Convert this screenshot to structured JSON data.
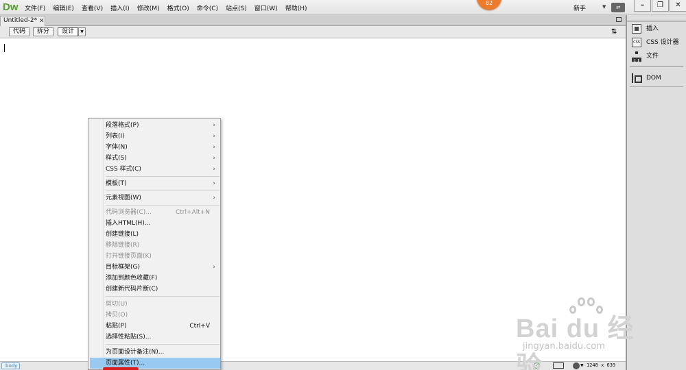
{
  "menubar": {
    "logo": "Dw",
    "items": [
      "文件(F)",
      "编辑(E)",
      "查看(V)",
      "插入(I)",
      "修改(M)",
      "格式(O)",
      "命令(C)",
      "站点(S)",
      "窗口(W)",
      "帮助(H)"
    ],
    "badge": "82",
    "workspace": "新手"
  },
  "document": {
    "tab_label": "Untitled-2*",
    "views": {
      "code": "代码",
      "split": "拆分",
      "design": "设计"
    }
  },
  "statusbar": {
    "tag": "body",
    "size": "1248 x 639"
  },
  "panel": {
    "items": [
      "插入",
      "CSS 设计器",
      "文件",
      "DOM"
    ]
  },
  "context_menu": {
    "items": [
      {
        "label": "段落格式(P)",
        "submenu": true
      },
      {
        "label": "列表(I)",
        "submenu": true
      },
      {
        "label": "字体(N)",
        "submenu": true
      },
      {
        "label": "样式(S)",
        "submenu": true
      },
      {
        "label": "CSS 样式(C)",
        "submenu": true
      },
      {
        "label": "模板(T)",
        "submenu": true
      },
      {
        "label": "元素视图(W)",
        "submenu": true
      },
      {
        "label": "代码浏览器(C)...",
        "shortcut": "Ctrl+Alt+N",
        "disabled": true
      },
      {
        "label": "插入HTML(H)..."
      },
      {
        "label": "创建链接(L)"
      },
      {
        "label": "移除链接(R)",
        "disabled": true
      },
      {
        "label": "打开链接页面(K)",
        "disabled": true
      },
      {
        "label": "目标框架(G)",
        "submenu": true
      },
      {
        "label": "添加到颜色收藏(F)"
      },
      {
        "label": "创建新代码片断(C)"
      },
      {
        "label": "剪切(U)",
        "disabled": true
      },
      {
        "label": "拷贝(O)",
        "disabled": true
      },
      {
        "label": "粘贴(P)",
        "shortcut": "Ctrl+V"
      },
      {
        "label": "选择性粘贴(S)..."
      },
      {
        "label": "为页面设计备注(N)..."
      },
      {
        "label": "页面属性(T)...",
        "highlighted": true
      }
    ]
  },
  "watermark": {
    "brand": "Bai du 经验",
    "url": "jingyan.baidu.com"
  },
  "colors": {
    "logo": "#57a02f",
    "badge": "#ee7a2c",
    "menu_highlight": "#99c9ef"
  }
}
